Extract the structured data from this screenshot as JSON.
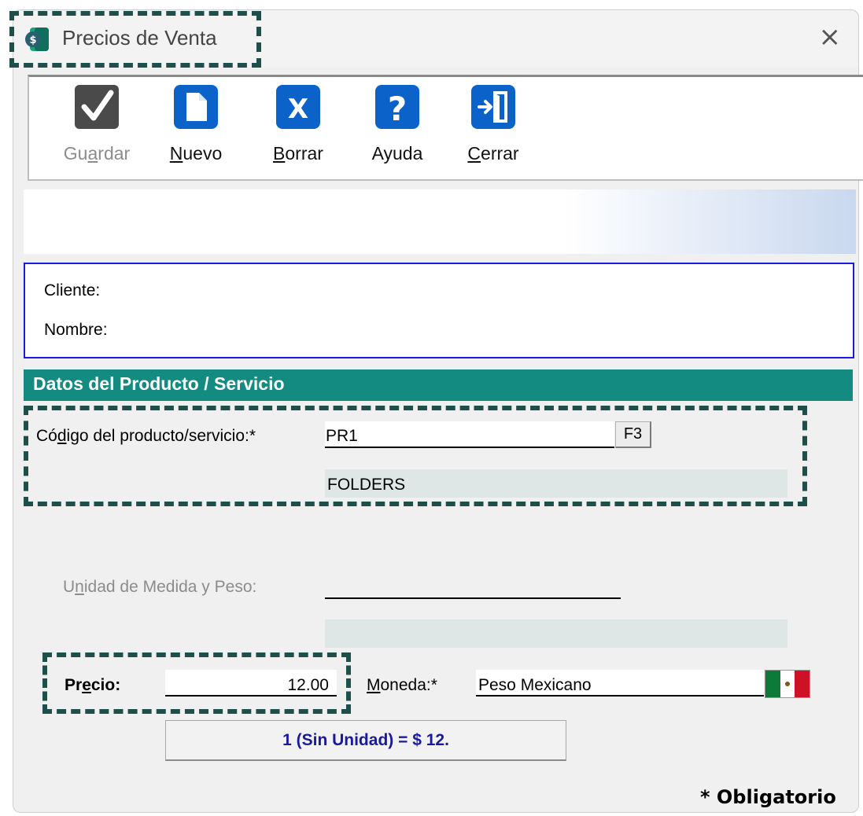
{
  "window": {
    "title": "Precios de Venta",
    "close_glyph": "×"
  },
  "toolbar": {
    "guardar": {
      "pre": "Gu",
      "u": "a",
      "post": "rdar",
      "icon": "check-icon"
    },
    "nuevo": {
      "u": "N",
      "post": "uevo",
      "icon": "document-icon"
    },
    "borrar": {
      "u": "B",
      "post": "orrar",
      "icon_text": "X",
      "icon": "delete-icon"
    },
    "ayuda": {
      "label": "Ayuda",
      "icon_text": "?",
      "icon": "help-icon"
    },
    "cerrar": {
      "u": "C",
      "post": "errar",
      "icon": "exit-icon"
    }
  },
  "cliente": {
    "cliente_label": "Cliente:",
    "nombre_label": "Nombre:"
  },
  "section": {
    "title": "Datos del Producto / Servicio"
  },
  "producto": {
    "label_pre": "Có",
    "label_u": "d",
    "label_post": "igo del producto/servicio:*",
    "code_value": "PR1",
    "f3_label": "F3",
    "description": "FOLDERS"
  },
  "unidad": {
    "label_pre": "U",
    "label_u": "n",
    "label_post": "idad de Medida y Peso:"
  },
  "precio": {
    "label_pre": "Pr",
    "label_u": "e",
    "label_post": "cio:",
    "value": "12.00"
  },
  "moneda": {
    "label_u": "M",
    "label_post": "oneda:*",
    "value": "Peso Mexicano"
  },
  "summary": {
    "text": "1 (Sin Unidad) = $ 12."
  },
  "footer": {
    "required_note": "* Obligatorio"
  },
  "colors": {
    "accent": "#138b80",
    "client_border": "#1a1ae0",
    "highlight": "#1f4f4a"
  }
}
